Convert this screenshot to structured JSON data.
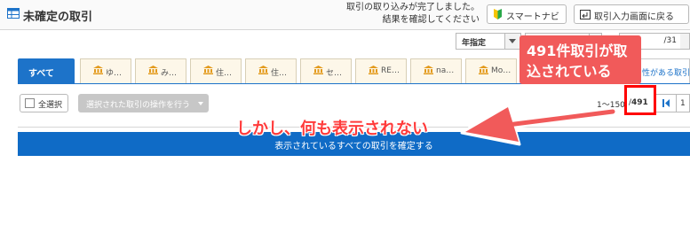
{
  "header": {
    "title": "未確定の取引",
    "notice_line1": "取引の取り込みが完了しました。",
    "notice_line2": "結果を確認してください",
    "smart_navi_label": "スマートナビ",
    "back_label": "取引入力画面に戻る"
  },
  "filters": {
    "period_selected": "年指定",
    "date_to_value": "/31"
  },
  "tabs": {
    "all_label": "すべて",
    "accounts": [
      {
        "label": "ゆ…"
      },
      {
        "label": "み…"
      },
      {
        "label": "住…"
      },
      {
        "label": "住…"
      },
      {
        "label": "セ…"
      },
      {
        "label": "RE…"
      },
      {
        "label": "na…"
      },
      {
        "label": "Mo…"
      }
    ],
    "related_label": "性がある取引"
  },
  "actions": {
    "select_all_label": "全選択",
    "bulk_operation_label": "選択された取引の操作を行う",
    "range_text": "1〜150",
    "range_separator": "/",
    "total_count": "491",
    "page_one": "1"
  },
  "confirm_bar": {
    "label": "表示されているすべての取引を確定する"
  },
  "annotations": {
    "callout_line1": "491件取引が取",
    "callout_line2": "込されている",
    "message": "しかし、何も表示されない",
    "color": "#f15a5a"
  },
  "colors": {
    "primary_blue": "#0f6bc6",
    "tab_bg": "#fdf7e9",
    "highlight_red": "#ff0000"
  }
}
